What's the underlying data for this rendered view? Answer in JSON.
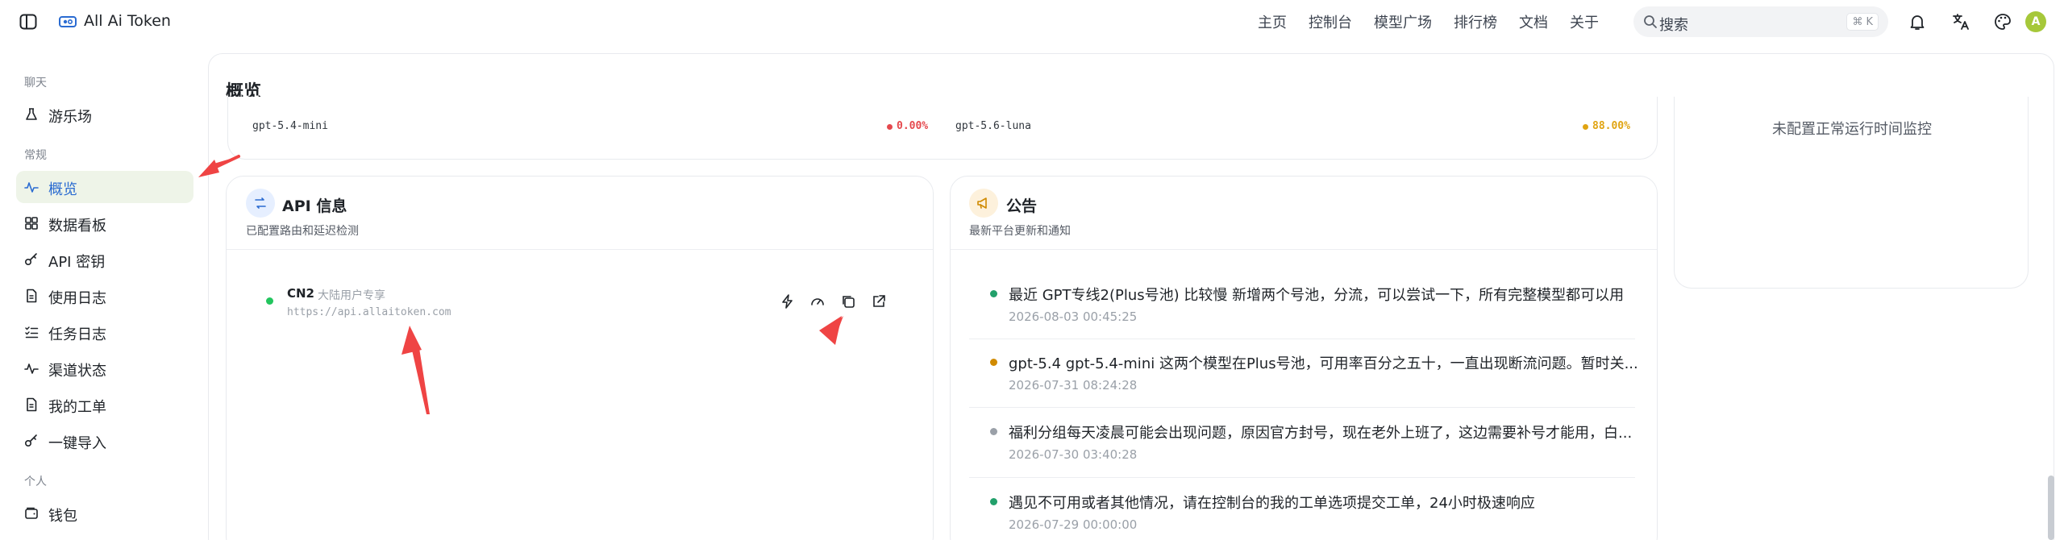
{
  "header": {
    "brand": "All Ai Token",
    "nav": [
      "主页",
      "控制台",
      "模型广场",
      "排行榜",
      "文档",
      "关于"
    ],
    "search_placeholder": "搜索",
    "search_kbd_mod": "⌘",
    "search_kbd_key": "K",
    "avatar_letter": "A"
  },
  "sidebar": {
    "sections": [
      "聊天",
      "常规",
      "个人"
    ],
    "items": [
      {
        "label": "游乐场",
        "icon": "flask-icon"
      },
      {
        "label": "概览",
        "icon": "activity-icon",
        "active": true
      },
      {
        "label": "数据看板",
        "icon": "dashboard-icon"
      },
      {
        "label": "API 密钥",
        "icon": "key-icon"
      },
      {
        "label": "使用日志",
        "icon": "document-icon"
      },
      {
        "label": "任务日志",
        "icon": "list-icon"
      },
      {
        "label": "渠道状态",
        "icon": "activity-icon"
      },
      {
        "label": "我的工单",
        "icon": "ticket-icon"
      },
      {
        "label": "一键导入",
        "icon": "key-icon"
      },
      {
        "label": "钱包",
        "icon": "wallet-icon"
      }
    ]
  },
  "main": {
    "title": "概览",
    "models": [
      {
        "name": "gpt-5.4-mini",
        "pct": "0.00%",
        "color": "#e5484d"
      },
      {
        "name": "gpt-5.6-luna",
        "pct": "88.00%",
        "color": "#e0a412"
      }
    ],
    "uptime_empty": "未配置正常运行时间监控",
    "api_card": {
      "title": "API 信息",
      "subtitle": "已配置路由和延迟检测",
      "route_name": "CN2",
      "route_tag": "大陆用户专享",
      "route_url": "https://api.allaitoken.com",
      "status_color": "#22c55e"
    },
    "notice_card": {
      "title": "公告",
      "subtitle": "最新平台更新和通知",
      "items": [
        {
          "text": "最近 GPT专线2(Plus号池) 比较慢 新增两个号池，分流，可以尝试一下，所有完整模型都可以用",
          "time": "2026-08-03 00:45:25",
          "color": "#22a06b"
        },
        {
          "text": "gpt-5.4 gpt-5.4-mini 这两个模型在Plus号池，可用率百分之五十，一直出现断流问题。暂时关...",
          "time": "2026-07-31 08:24:28",
          "color": "#d08a00"
        },
        {
          "text": "福利分组每天凌晨可能会出现问题，原因官方封号，现在老外上班了，这边需要补号才能用，白...",
          "time": "2026-07-30 03:40:28",
          "color": "#9aa0a8"
        },
        {
          "text": "遇见不可用或者其他情况，请在控制台的我的工单选项提交工单，24小时极速响应",
          "time": "2026-07-29 00:00:00",
          "color": "#22a06b"
        }
      ]
    }
  },
  "colors": {
    "accent": "#2a6bd1",
    "active_bg": "#eef4e8",
    "arrow": "#ef4444"
  }
}
